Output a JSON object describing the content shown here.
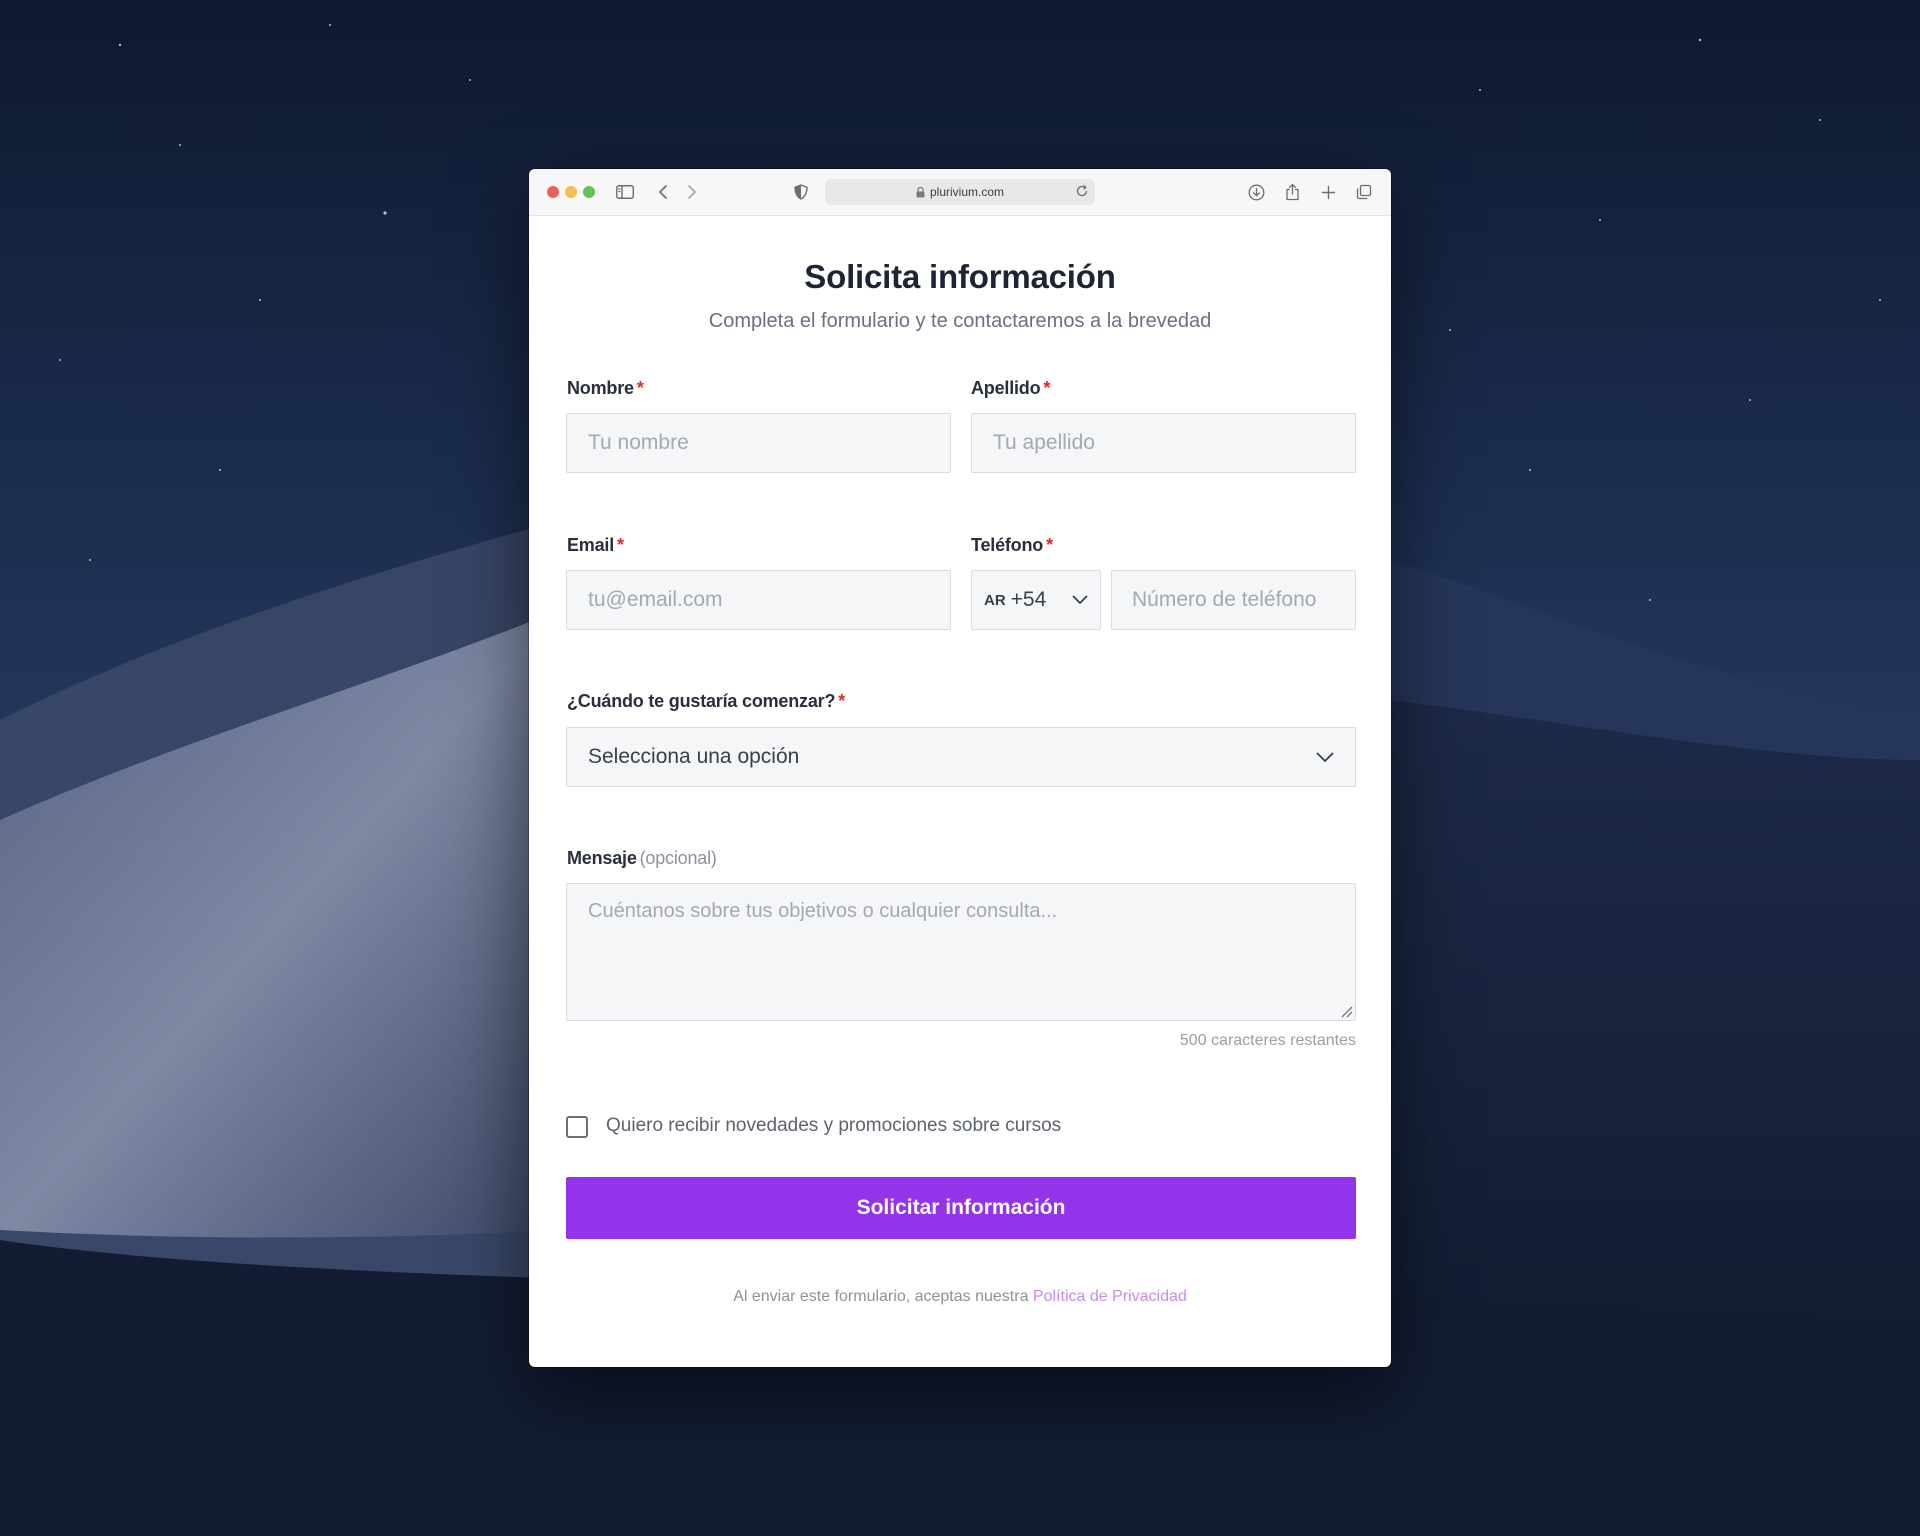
{
  "browser": {
    "url": "plurivium.com",
    "icons": [
      "sidebar-icon",
      "back-icon",
      "forward-icon",
      "privacy-shield-icon",
      "lock-icon",
      "reload-icon",
      "downloads-icon",
      "share-icon",
      "new-tab-icon",
      "tab-overview-icon"
    ]
  },
  "form": {
    "title": "Solicita información",
    "subtitle": "Completa el formulario y te contactaremos a la brevedad",
    "required_marker": "*",
    "first_name": {
      "label": "Nombre",
      "placeholder": "Tu nombre",
      "value": ""
    },
    "last_name": {
      "label": "Apellido",
      "placeholder": "Tu apellido",
      "value": ""
    },
    "email": {
      "label": "Email",
      "placeholder": "tu@email.com",
      "value": ""
    },
    "phone": {
      "label": "Teléfono",
      "country_code": "AR",
      "dial_code": "+54",
      "placeholder": "Número de teléfono",
      "value": ""
    },
    "start_time": {
      "label": "¿Cuándo te gustaría comenzar?",
      "selected": "Selecciona una opción"
    },
    "message": {
      "label": "Mensaje",
      "optional_note": "(opcional)",
      "placeholder": "Cuéntanos sobre tus objetivos o cualquier consulta...",
      "value": "",
      "counter": "500 caracteres restantes"
    },
    "newsletter": {
      "label": "Quiero recibir novedades y promociones sobre cursos",
      "checked": false
    },
    "submit_label": "Solicitar información",
    "legal_text": "Al enviar este formulario, aceptas nuestra",
    "privacy_link": "Política de Privacidad"
  },
  "colors": {
    "accent": "#9333ea",
    "required": "#e02828",
    "link": "#c98be6",
    "field_bg": "#f5f6f8"
  }
}
